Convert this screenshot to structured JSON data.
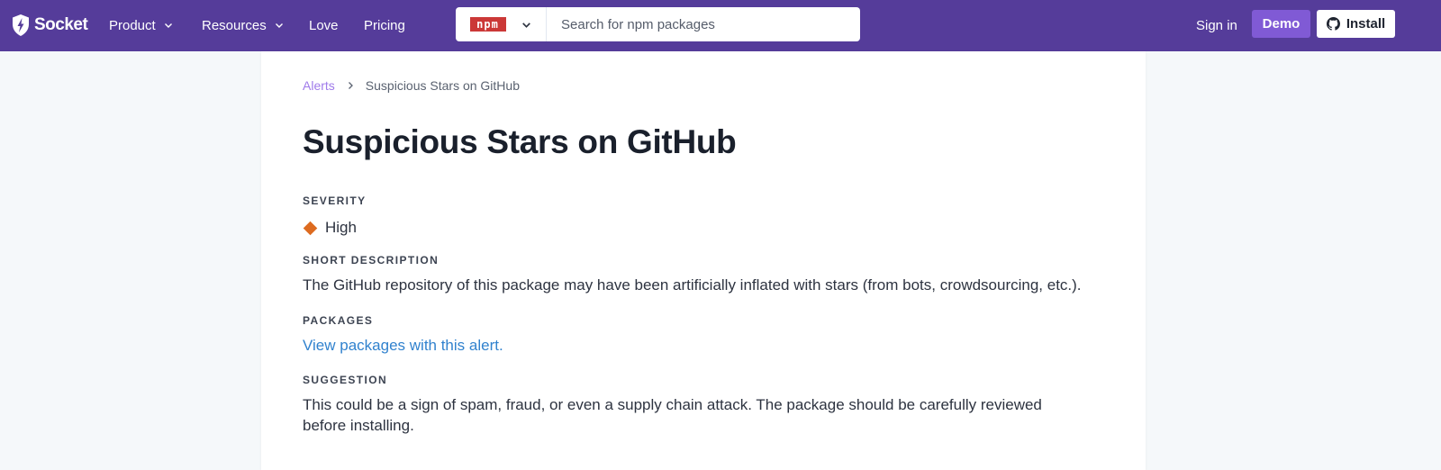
{
  "nav": {
    "logo_text": "Socket",
    "items": [
      {
        "label": "Product",
        "has_dropdown": true
      },
      {
        "label": "Resources",
        "has_dropdown": true
      },
      {
        "label": "Love",
        "has_dropdown": false
      },
      {
        "label": "Pricing",
        "has_dropdown": false
      }
    ],
    "registry_badge": "npm",
    "search_placeholder": "Search for npm packages",
    "signin_label": "Sign in",
    "demo_label": "Demo",
    "install_label": "Install",
    "install_icon": "github-icon",
    "colors": {
      "bar": "#553c9a",
      "demo": "#805ad5",
      "npm": "#cb3837"
    }
  },
  "breadcrumb": {
    "parent": "Alerts",
    "current": "Suspicious Stars on GitHub"
  },
  "alert": {
    "title": "Suspicious Stars on GitHub",
    "severity_label": "SEVERITY",
    "severity_value": "High",
    "severity_color": "#dd6b20",
    "short_description_label": "SHORT DESCRIPTION",
    "short_description": "The GitHub repository of this package may have been artificially inflated with stars (from bots, crowdsourcing, etc.).",
    "packages_label": "PACKAGES",
    "packages_link": "View packages with this alert.",
    "suggestion_label": "SUGGESTION",
    "suggestion": "This could be a sign of spam, fraud, or even a supply chain attack. The package should be carefully reviewed before installing."
  }
}
